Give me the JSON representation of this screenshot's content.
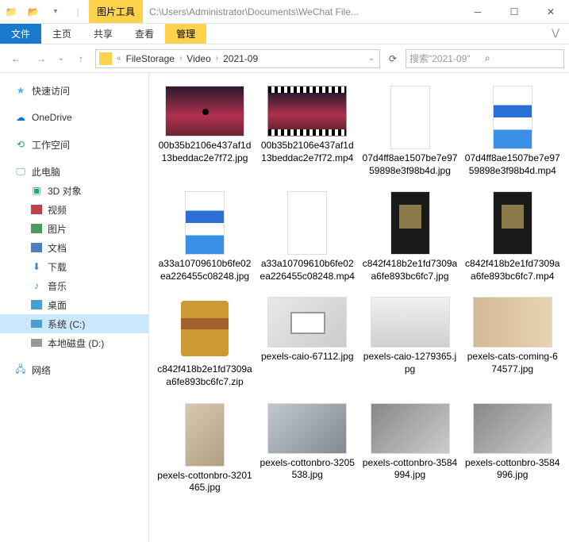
{
  "titlebar": {
    "context_tab": "图片工具",
    "path": "C:\\Users\\Administrator\\Documents\\WeChat File..."
  },
  "ribbon": {
    "file": "文件",
    "tabs": [
      "主页",
      "共享",
      "查看"
    ],
    "context": "管理"
  },
  "breadcrumb": {
    "items": [
      "FileStorage",
      "Video",
      "2021-09"
    ]
  },
  "search": {
    "placeholder": "搜索\"2021-09\""
  },
  "sidebar": {
    "quick": "快速访问",
    "onedrive": "OneDrive",
    "workspace": "工作空间",
    "pc": "此电脑",
    "children": [
      {
        "label": "3D 对象"
      },
      {
        "label": "视频"
      },
      {
        "label": "图片"
      },
      {
        "label": "文档"
      },
      {
        "label": "下载"
      },
      {
        "label": "音乐"
      },
      {
        "label": "桌面"
      },
      {
        "label": "系统 (C:)",
        "selected": true
      },
      {
        "label": "本地磁盘 (D:)"
      }
    ],
    "network": "网络"
  },
  "files": [
    {
      "name": "00b35b2106e437af1d13beddac2e7f72.jpg",
      "thumb": "sunset"
    },
    {
      "name": "00b35b2106e437af1d13beddac2e7f72.mp4",
      "thumb": "video-sunset"
    },
    {
      "name": "07d4ff8ae1507be7e9759898e3f98b4d.jpg",
      "thumb": "white-tall"
    },
    {
      "name": "07d4ff8ae1507be7e9759898e3f98b4d.mp4",
      "thumb": "blue-tall"
    },
    {
      "name": "a33a10709610b6fe02ea226455c08248.jpg",
      "thumb": "blue-tall"
    },
    {
      "name": "a33a10709610b6fe02ea226455c08248.mp4",
      "thumb": "white-tall"
    },
    {
      "name": "c842f418b2e1fd7309aa6fe893bc6fc7.jpg",
      "thumb": "dark-tall"
    },
    {
      "name": "c842f418b2e1fd7309aa6fe893bc6fc7.mp4",
      "thumb": "dark-tall"
    },
    {
      "name": "c842f418b2e1fd7309aa6fe893bc6fc7.zip",
      "thumb": "zip"
    },
    {
      "name": "pexels-caio-67112.jpg",
      "thumb": "laptop"
    },
    {
      "name": "pexels-caio-1279365.jpg",
      "thumb": "speaker"
    },
    {
      "name": "pexels-cats-coming-674577.jpg",
      "thumb": "cat"
    },
    {
      "name": "pexels-cottonbro-3201465.jpg",
      "thumb": "person-tall"
    },
    {
      "name": "pexels-cottonbro-3205538.jpg",
      "thumb": "person2"
    },
    {
      "name": "pexels-cottonbro-3584994.jpg",
      "thumb": "office"
    },
    {
      "name": "pexels-cottonbro-3584996.jpg",
      "thumb": "office"
    }
  ]
}
